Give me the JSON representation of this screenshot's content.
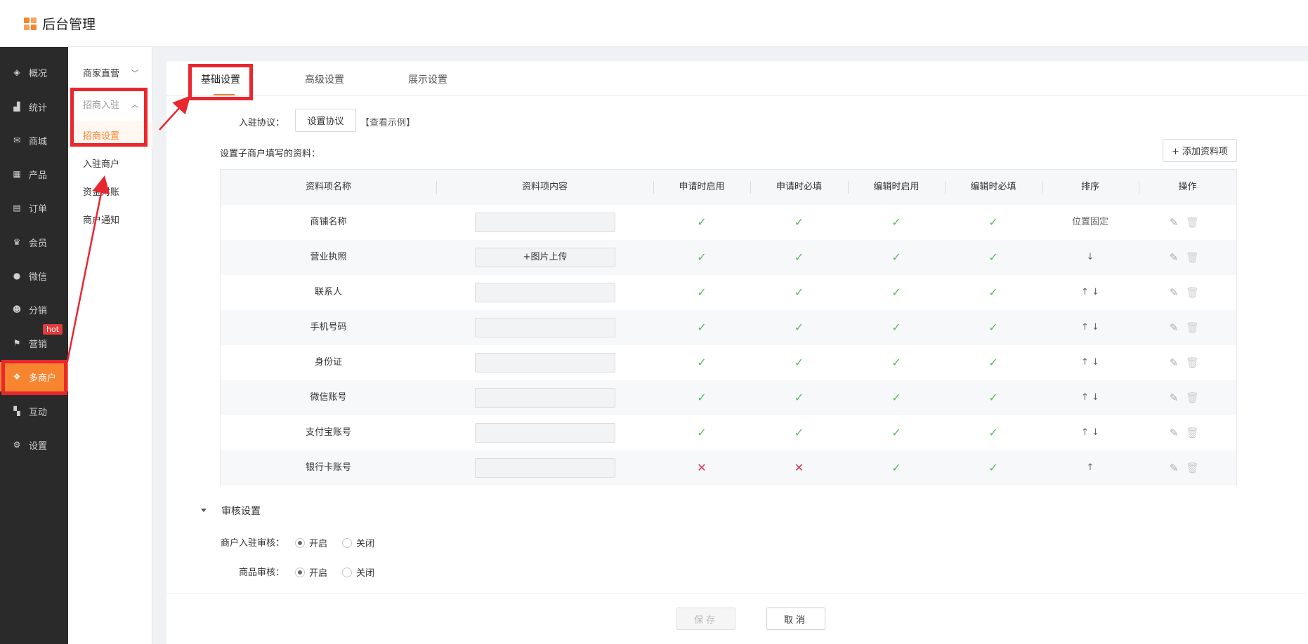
{
  "app": {
    "title": "后台管理"
  },
  "leftnav": {
    "items": [
      {
        "label": "概况",
        "icon": "layers-icon"
      },
      {
        "label": "统计",
        "icon": "chart-icon"
      },
      {
        "label": "商城",
        "icon": "shop-icon"
      },
      {
        "label": "产品",
        "icon": "grid-icon"
      },
      {
        "label": "订单",
        "icon": "order-icon"
      },
      {
        "label": "会员",
        "icon": "crown-icon"
      },
      {
        "label": "微信",
        "icon": "wechat-icon"
      },
      {
        "label": "分销",
        "icon": "users-icon"
      },
      {
        "label": "营销",
        "icon": "flag-icon"
      },
      {
        "label": "多商户",
        "icon": "merchant-icon"
      },
      {
        "label": "互动",
        "icon": "interact-icon"
      },
      {
        "label": "设置",
        "icon": "gear-icon"
      }
    ],
    "hot_badge": "hot"
  },
  "subnav": {
    "items": [
      "商家直营",
      "招商入驻",
      "招商设置",
      "入驻商户",
      "资金对账",
      "商户通知"
    ]
  },
  "tabs": [
    "基础设置",
    "高级设置",
    "展示设置"
  ],
  "agreement": {
    "label": "入驻协议：",
    "button": "设置协议",
    "example": "【查看示例】"
  },
  "fields_section": {
    "label": "设置子商户填写的资料：",
    "add_button": "+ 添加资料项"
  },
  "table": {
    "headers": [
      "资料项名称",
      "资料项内容",
      "申请时启用",
      "申请时必填",
      "编辑时启用",
      "编辑时必填",
      "排序",
      "操作"
    ],
    "rows": [
      {
        "name": "商铺名称",
        "content": "",
        "apply_enable": "✓",
        "apply_required": "✓",
        "edit_enable": "✓",
        "edit_required": "✓",
        "sort": "位置固定"
      },
      {
        "name": "营业执照",
        "content": "+图片上传",
        "apply_enable": "✓",
        "apply_required": "✓",
        "edit_enable": "✓",
        "edit_required": "✓",
        "sort": "↓"
      },
      {
        "name": "联系人",
        "content": "",
        "apply_enable": "✓",
        "apply_required": "✓",
        "edit_enable": "✓",
        "edit_required": "✓",
        "sort": "↑ ↓"
      },
      {
        "name": "手机号码",
        "content": "",
        "apply_enable": "✓",
        "apply_required": "✓",
        "edit_enable": "✓",
        "edit_required": "✓",
        "sort": "↑ ↓"
      },
      {
        "name": "身份证",
        "content": "",
        "apply_enable": "✓",
        "apply_required": "✓",
        "edit_enable": "✓",
        "edit_required": "✓",
        "sort": "↑ ↓"
      },
      {
        "name": "微信账号",
        "content": "",
        "apply_enable": "✓",
        "apply_required": "✓",
        "edit_enable": "✓",
        "edit_required": "✓",
        "sort": "↑ ↓"
      },
      {
        "name": "支付宝账号",
        "content": "",
        "apply_enable": "✓",
        "apply_required": "✓",
        "edit_enable": "✓",
        "edit_required": "✓",
        "sort": "↑ ↓"
      },
      {
        "name": "银行卡账号",
        "content": "",
        "apply_enable": "✕",
        "apply_required": "✕",
        "edit_enable": "✓",
        "edit_required": "✓",
        "sort": "↑"
      }
    ]
  },
  "review": {
    "title": "审核设置",
    "merchant_label": "商户入驻审核：",
    "product_label": "商品审核：",
    "on": "开启",
    "off": "关闭"
  },
  "footer": {
    "save": "保存",
    "cancel": "取消"
  },
  "colors": {
    "accent": "#f7842f",
    "highlight": "#e8272f",
    "check": "#5cb85c",
    "cross": "#e0304e"
  }
}
